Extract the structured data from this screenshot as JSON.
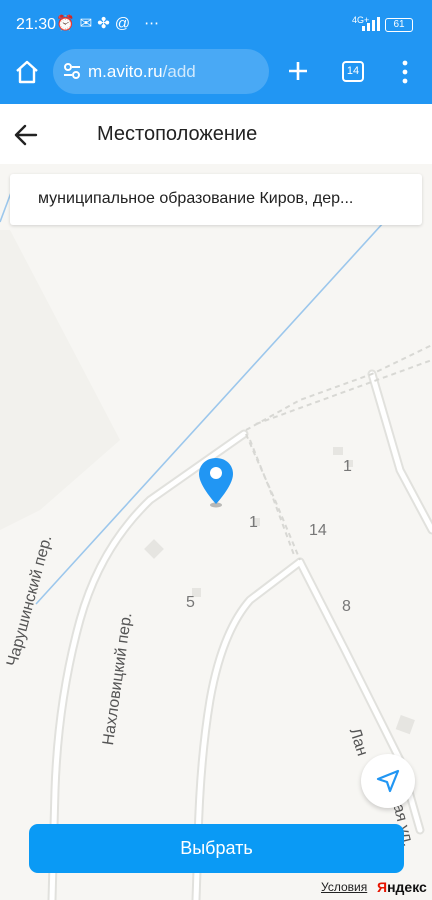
{
  "status_bar": {
    "time": "21:30",
    "network": "4G+",
    "battery": "61",
    "icons": [
      "alarm-icon",
      "chat-icon",
      "pinwheel-icon",
      "at-icon",
      "more-dots-icon"
    ]
  },
  "browser": {
    "url_host": "m.avito.ru",
    "url_path": "/add",
    "tab_count": "14"
  },
  "header": {
    "title": "Местоположение"
  },
  "address": {
    "value": "муниципальное образование Киров, дер..."
  },
  "map": {
    "streets": {
      "charushinsky": "Чарушинский пер.",
      "nakhlovitsky": "Нахловицкий пер.",
      "lan": "Лан",
      "vaya": "вая ул."
    },
    "house_numbers": [
      "1",
      "1",
      "14",
      "5",
      "8"
    ],
    "attribution": "Условия",
    "logo_y": "Я",
    "logo_rest": "ндекс"
  },
  "actions": {
    "select_label": "Выбрать"
  },
  "colors": {
    "chrome": "#2196f3",
    "button": "#0a9af5",
    "pin": "#2196f3"
  }
}
